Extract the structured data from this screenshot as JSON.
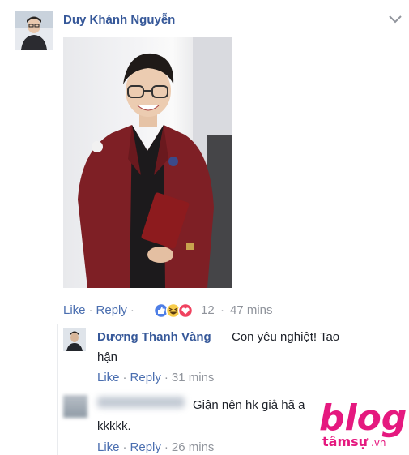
{
  "post": {
    "author": "Duy Khánh Nguyễn",
    "like_label": "Like",
    "reply_label": "Reply",
    "reaction_count": "12",
    "time": "47 mins",
    "reaction_icons": [
      "like-reaction-icon",
      "haha-reaction-icon",
      "love-reaction-icon"
    ]
  },
  "reply1": {
    "name": "Dương Thanh Vàng",
    "text_line1": "Con yêu nghiệt! Tao",
    "text_line2": "hận",
    "like_label": "Like",
    "reply_label": "Reply",
    "time": "31 mins"
  },
  "reply2": {
    "text_line1": "Giận nên hk giả hã a",
    "text_line2": "kkkkk.",
    "like_label": "Like",
    "reply_label": "Reply",
    "time": "26 mins"
  },
  "watermark": {
    "brand": "blog",
    "sub": "tâmsự",
    "tld": ".vn"
  },
  "colors": {
    "link": "#365899",
    "muted": "#90949c",
    "watermark": "#e5197f"
  }
}
